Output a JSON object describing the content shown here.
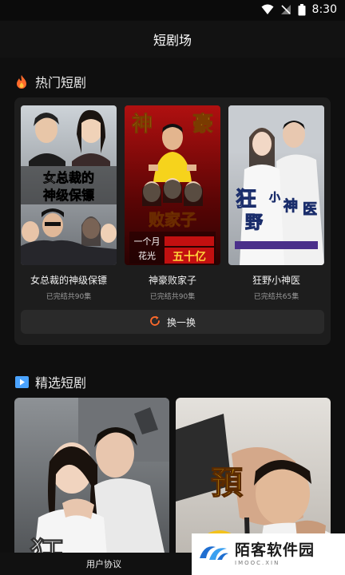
{
  "status": {
    "time": "8:30"
  },
  "header": {
    "title": "短剧场"
  },
  "hot": {
    "title": "热门短剧",
    "items": [
      {
        "title": "女总裁的神级保镖",
        "sub": "已完结共90集",
        "poster_text": "女总裁的神级保镖"
      },
      {
        "title": "神豪败家子",
        "sub": "已完结共90集",
        "poster_top": "神 豪",
        "poster_mid": "败家子",
        "poster_line1": "一个月",
        "poster_line2": "花光五十亿"
      },
      {
        "title": "狂野小神医",
        "sub": "已完结共65集",
        "poster_text": "狂野小神医"
      }
    ],
    "refresh_label": "换一换"
  },
  "featured": {
    "title": "精选短剧",
    "poster_text_left": "狂",
    "poster_text_right": "預"
  },
  "footer": {
    "user_agreement": "用户协议"
  },
  "watermark": {
    "name": "陌客软件园",
    "url": "IMOOC.XIN"
  },
  "colors": {
    "background": "#0f0f0f",
    "card": "#1d1d1d",
    "accent_orange": "#ff6a2b",
    "accent_blue": "#4aa3ff"
  }
}
